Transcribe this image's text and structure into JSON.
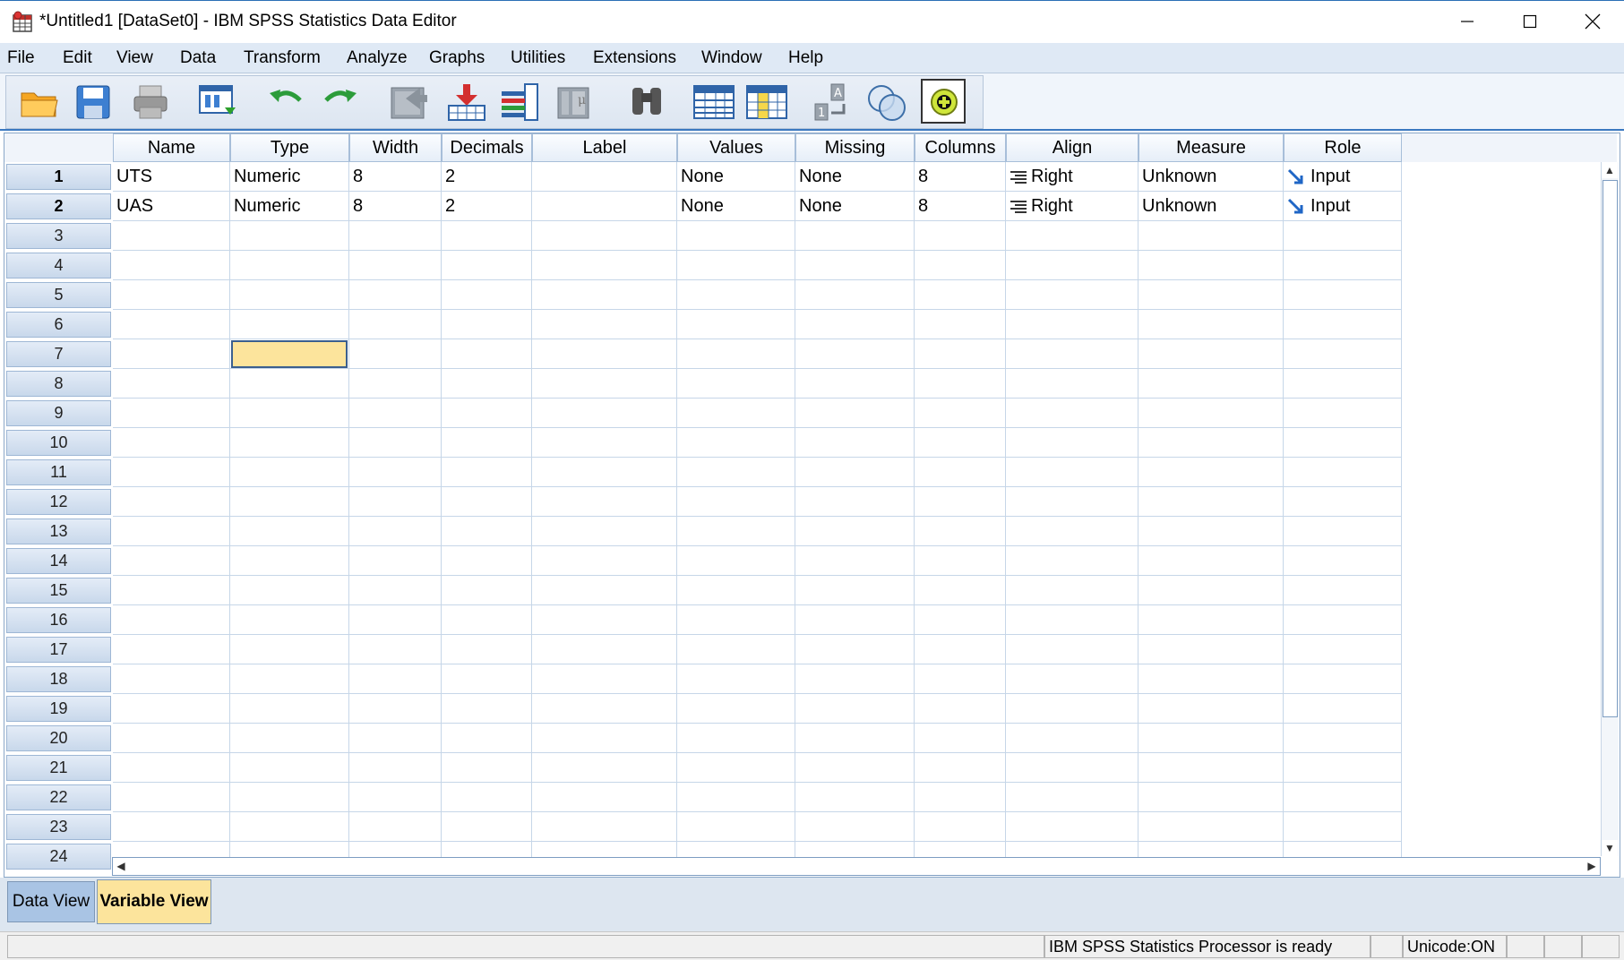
{
  "window": {
    "title": "*Untitled1 [DataSet0] - IBM SPSS Statistics Data Editor"
  },
  "menu": [
    "File",
    "Edit",
    "View",
    "Data",
    "Transform",
    "Analyze",
    "Graphs",
    "Utilities",
    "Extensions",
    "Window",
    "Help"
  ],
  "toolbar_icons": [
    "open-folder-icon",
    "save-icon",
    "print-icon",
    "recall-dialog-icon",
    "undo-icon",
    "redo-icon",
    "goto-case-icon",
    "goto-variable-icon",
    "variables-icon",
    "run-descriptive-icon",
    "find-icon",
    "insert-cases-icon",
    "insert-variable-icon",
    "split-file-icon",
    "select-cases-icon",
    "value-labels-icon",
    "use-variable-sets-icon"
  ],
  "columns": [
    "Name",
    "Type",
    "Width",
    "Decimals",
    "Label",
    "Values",
    "Missing",
    "Columns",
    "Align",
    "Measure",
    "Role"
  ],
  "rows": [
    {
      "Name": "UTS",
      "Type": "Numeric",
      "Width": "8",
      "Decimals": "2",
      "Label": "",
      "Values": "None",
      "Missing": "None",
      "Columns": "8",
      "Align": "Right",
      "Measure": "Unknown",
      "Role": "Input"
    },
    {
      "Name": "UAS",
      "Type": "Numeric",
      "Width": "8",
      "Decimals": "2",
      "Label": "",
      "Values": "None",
      "Missing": "None",
      "Columns": "8",
      "Align": "Right",
      "Measure": "Unknown",
      "Role": "Input"
    }
  ],
  "row_numbers": [
    "1",
    "2",
    "3",
    "4",
    "5",
    "6",
    "7",
    "8",
    "9",
    "10",
    "11",
    "12",
    "13",
    "14",
    "15",
    "16",
    "17",
    "18",
    "19",
    "20",
    "21",
    "22",
    "23",
    "24"
  ],
  "tabs": {
    "data_view": "Data View",
    "variable_view": "Variable View",
    "active": "variable_view"
  },
  "status": {
    "processor": "IBM SPSS Statistics Processor is ready",
    "unicode": "Unicode:ON"
  },
  "colors": {
    "selected_cell": "#fce49c",
    "active_tab": "#fce49c",
    "inactive_tab": "#a9c4e4",
    "menu_bg": "#dfe9f5",
    "header_bg": "#e6eef8"
  }
}
